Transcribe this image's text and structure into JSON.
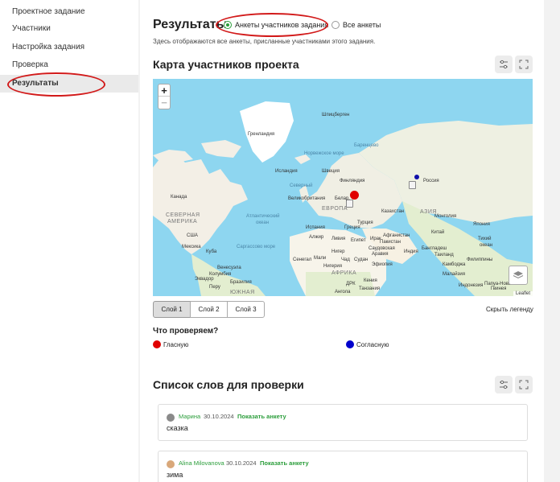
{
  "sidebar": {
    "items": [
      {
        "label": "Проектное задание"
      },
      {
        "label": "Участники"
      },
      {
        "label": "Настройка задания"
      },
      {
        "label": "Проверка"
      },
      {
        "label": "Результаты",
        "active": true
      }
    ]
  },
  "results": {
    "title": "Результаты",
    "radio_options": [
      {
        "label": "Анкеты участников задания",
        "checked": true
      },
      {
        "label": "Все анкеты",
        "checked": false
      }
    ],
    "description": "Здесь отображаются все анкеты, присланные участниками этого задания."
  },
  "map_section": {
    "title": "Карта участников проекта",
    "zoom_in": "+",
    "zoom_out": "−",
    "attribution": "Leaflet",
    "labels": {
      "greenland": "Гренландия",
      "svalbard": "Шпицберген",
      "iceland": "Исландия",
      "sweden": "Швеция",
      "finland": "Финляндия",
      "russia": "Россия",
      "canada": "Канада",
      "north_america": "СЕВЕРНАЯ",
      "north_america_2": "АМЕРИКА",
      "uk": "Великобритания",
      "europe": "ЕВРОПА",
      "belarus": "Белар.",
      "kazakhstan": "Казахстан",
      "asia": "АЗИЯ",
      "mongolia": "Монголия",
      "usa": "США",
      "spain": "Испания",
      "greece": "Греция",
      "turkey": "Турция",
      "china": "Китай",
      "japan": "Япония",
      "afghanistan": "Афганистан",
      "iran": "Иран",
      "iraq": "Ирак",
      "pakistan": "Пакистан",
      "algeria": "Алжир",
      "libya": "Ливия",
      "egypt": "Египет",
      "mexico": "Мексика",
      "cuba": "Куба",
      "saudi": "Саудовская",
      "saudi_2": "Аравия",
      "india": "Индия",
      "bangladesh": "Бангладеш",
      "thailand": "Таиланд",
      "mali": "Мали",
      "niger": "Нигер",
      "chad": "Чад",
      "sudan": "Судан",
      "senegal": "Сенегал",
      "ethiopia": "Эфиопия",
      "venezuela": "Венесуэла",
      "colombia": "Колумбия",
      "ecuador": "Эквадор",
      "brazil": "Бразилия",
      "peru": "Перу",
      "south": "ЮЖНАЯ",
      "africa": "АФРИКА",
      "nigeria": "Нигерия",
      "drc": "ДРК",
      "kenya": "Кения",
      "tanzania": "Танзания",
      "angola": "Ангола",
      "indonesia": "Индонезия",
      "cambodia": "Камбоджа",
      "malaysia": "Малайзия",
      "philippines": "Филиппины",
      "png": "Папуа-Новая",
      "png_2": "Гвинея",
      "sargasso": "Саргассово море",
      "north_sea": "Северный",
      "ocean_atl": "Атлантический",
      "ocean_atl_2": "океан",
      "barents": "Баренцево",
      "norway": "Норвежское море",
      "ocean_pac": "Тихий",
      "ocean_pac_2": "океан"
    },
    "layers": [
      "Слой 1",
      "Слой 2",
      "Слой 3"
    ],
    "hide_legend": "Скрыть легенду",
    "legend_title": "Что проверяем?",
    "legend_items": [
      {
        "label": "Гласную",
        "color": "#e00000"
      },
      {
        "label": "Согласную",
        "color": "#0000cc"
      }
    ]
  },
  "words_section": {
    "title": "Список слов для проверки",
    "items": [
      {
        "author": "Марина",
        "date": "30.10.2024",
        "link": "Показать анкету",
        "word": "сказка"
      },
      {
        "author": "Alina Milovanova",
        "date": "30.10.2024",
        "link": "Показать анкету",
        "word": "зима"
      }
    ]
  }
}
